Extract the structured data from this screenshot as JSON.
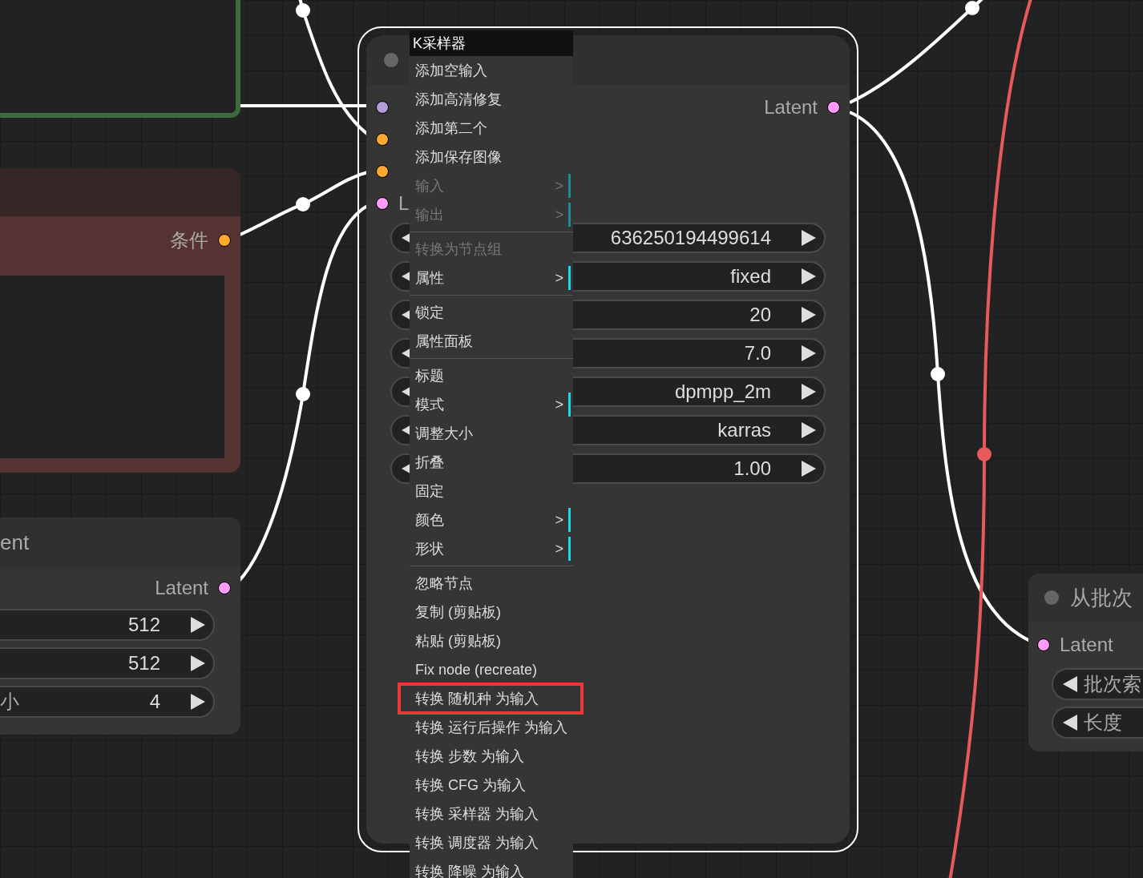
{
  "conditioning_node": {
    "output": {
      "label": "条件",
      "color": "#ffa931"
    }
  },
  "latent_node": {
    "title": "ent",
    "output": {
      "label": "Latent",
      "color": "#ff9cf9"
    },
    "widgets": [
      {
        "value": "512"
      },
      {
        "value": "512"
      },
      {
        "label": "小",
        "value": "4"
      }
    ]
  },
  "sampler_node": {
    "selected": true,
    "inputs": [
      {
        "color": "#b39ddb"
      },
      {
        "color": "#ffa931"
      },
      {
        "color": "#ffa931"
      },
      {
        "color": "#ff9cf9",
        "label": "L"
      }
    ],
    "output": {
      "label": "Latent",
      "color": "#ff9cf9"
    },
    "widgets": [
      {
        "value": "636250194499614"
      },
      {
        "value": "fixed"
      },
      {
        "value": "20"
      },
      {
        "value": "7.0"
      },
      {
        "value": "dpmpp_2m"
      },
      {
        "value": "karras"
      },
      {
        "value": "1.00"
      }
    ]
  },
  "context_menu": {
    "title": "K采样器",
    "items": [
      {
        "kind": "item",
        "label": "添加空输入",
        "disabled": false,
        "highlighted": false
      },
      {
        "kind": "item",
        "label": "添加高清修复",
        "disabled": false,
        "highlighted": false
      },
      {
        "kind": "item",
        "label": "添加第二个",
        "disabled": false,
        "highlighted": false
      },
      {
        "kind": "item",
        "label": "添加保存图像",
        "disabled": false,
        "highlighted": false
      },
      {
        "kind": "item",
        "label": "输入",
        "arrow": ">",
        "disabled": true,
        "highlighted": false
      },
      {
        "kind": "item",
        "label": "输出",
        "arrow": ">",
        "disabled": true,
        "highlighted": false
      },
      {
        "kind": "separator"
      },
      {
        "kind": "item",
        "label": "转换为节点组",
        "disabled": true,
        "highlighted": false
      },
      {
        "kind": "item",
        "label": "属性",
        "arrow": ">",
        "disabled": false,
        "highlighted": false
      },
      {
        "kind": "separator"
      },
      {
        "kind": "item",
        "label": "锁定",
        "disabled": false,
        "highlighted": false
      },
      {
        "kind": "item",
        "label": "属性面板",
        "disabled": false,
        "highlighted": false
      },
      {
        "kind": "separator"
      },
      {
        "kind": "item",
        "label": "标题",
        "disabled": false,
        "highlighted": false
      },
      {
        "kind": "item",
        "label": "模式",
        "arrow": ">",
        "disabled": false,
        "highlighted": false
      },
      {
        "kind": "item",
        "label": "调整大小",
        "disabled": false,
        "highlighted": false
      },
      {
        "kind": "item",
        "label": "折叠",
        "disabled": false,
        "highlighted": false
      },
      {
        "kind": "item",
        "label": "固定",
        "disabled": false,
        "highlighted": false
      },
      {
        "kind": "item",
        "label": "颜色",
        "arrow": ">",
        "disabled": false,
        "highlighted": false
      },
      {
        "kind": "item",
        "label": "形状",
        "arrow": ">",
        "disabled": false,
        "highlighted": false
      },
      {
        "kind": "separator"
      },
      {
        "kind": "item",
        "label": "忽略节点",
        "disabled": false,
        "highlighted": false
      },
      {
        "kind": "item",
        "label": "复制 (剪贴板)",
        "disabled": false,
        "highlighted": false
      },
      {
        "kind": "item",
        "label": "粘贴 (剪贴板)",
        "disabled": false,
        "highlighted": false
      },
      {
        "kind": "item",
        "label": "Fix node (recreate)",
        "disabled": false,
        "highlighted": false
      },
      {
        "kind": "item",
        "label": "转换 随机种 为输入",
        "disabled": false,
        "highlighted": true
      },
      {
        "kind": "item",
        "label": "转换 运行后操作 为输入",
        "disabled": false,
        "highlighted": false
      },
      {
        "kind": "item",
        "label": "转换 步数 为输入",
        "disabled": false,
        "highlighted": false
      },
      {
        "kind": "item",
        "label": "转换 CFG 为输入",
        "disabled": false,
        "highlighted": false
      },
      {
        "kind": "item",
        "label": "转换 采样器 为输入",
        "disabled": false,
        "highlighted": false
      },
      {
        "kind": "item",
        "label": "转换 调度器 为输入",
        "disabled": false,
        "highlighted": false
      },
      {
        "kind": "item",
        "label": "转换 降噪 为输入",
        "disabled": false,
        "highlighted": false
      }
    ]
  },
  "batch_node": {
    "title": "从批次",
    "input": {
      "label": "Latent",
      "color": "#ff9cf9"
    },
    "widgets": [
      {
        "label": "批次索"
      },
      {
        "label": "长度"
      }
    ]
  }
}
